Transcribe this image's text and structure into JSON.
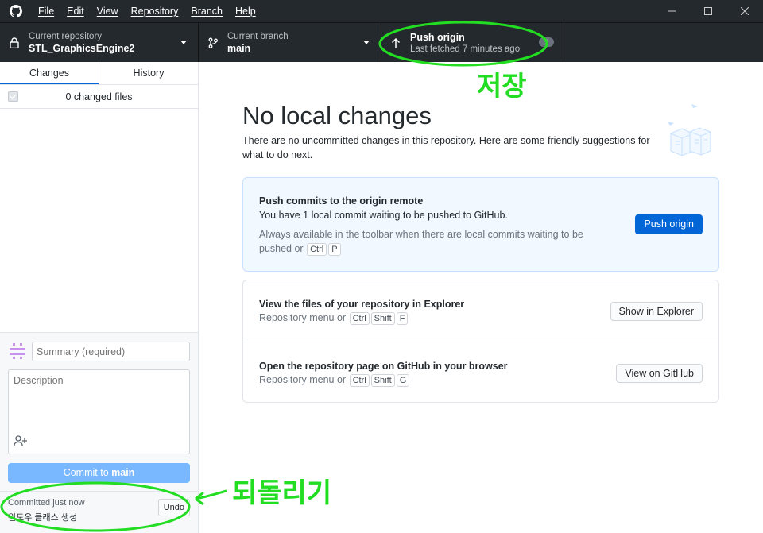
{
  "titlebar": {
    "menus": [
      {
        "first": "F",
        "rest": "ile"
      },
      {
        "first": "E",
        "rest": "dit"
      },
      {
        "first": "V",
        "rest": "iew"
      },
      {
        "first": "R",
        "rest": "epository"
      },
      {
        "first": "B",
        "rest": "ranch"
      },
      {
        "first": "H",
        "rest": "elp"
      }
    ]
  },
  "toolbar": {
    "repo_label": "Current repository",
    "repo_name": "STL_GraphicsEngine2",
    "branch_label": "Current branch",
    "branch_name": "main",
    "push_title": "Push origin",
    "push_sub": "Last fetched 7 minutes ago",
    "push_count": "1"
  },
  "sidebar": {
    "tabs": [
      "Changes",
      "History"
    ],
    "changed_files": "0 changed files",
    "summary_placeholder": "Summary (required)",
    "description_placeholder": "Description",
    "commit_prefix": "Commit to ",
    "commit_branch": "main",
    "undo": {
      "time": "Committed just now",
      "message": "윈도우 클래스 생성",
      "button": "Undo"
    }
  },
  "main": {
    "title": "No local changes",
    "description": "There are no uncommitted changes in this repository. Here are some friendly suggestions for what to do next.",
    "push_card": {
      "title": "Push commits to the origin remote",
      "line": "You have 1 local commit waiting to be pushed to GitHub.",
      "hint": "Always available in the toolbar when there are local commits waiting to be pushed or",
      "keys": [
        "Ctrl",
        "P"
      ],
      "button": "Push origin"
    },
    "explorer_card": {
      "title": "View the files of your repository in Explorer",
      "hint": "Repository menu or",
      "keys": [
        "Ctrl",
        "Shift",
        "F"
      ],
      "button": "Show in Explorer"
    },
    "github_card": {
      "title": "Open the repository page on GitHub in your browser",
      "hint": "Repository menu or",
      "keys": [
        "Ctrl",
        "Shift",
        "G"
      ],
      "button": "View on GitHub"
    }
  },
  "annotations": {
    "push_note": "저장",
    "undo_note": "되돌리기",
    "color": "#22dd22"
  },
  "colors": {
    "titlebar": "#24292e",
    "primary": "#0366d6",
    "commit_disabled": "#79b8ff",
    "push_card_bg": "#f1f8ff"
  }
}
